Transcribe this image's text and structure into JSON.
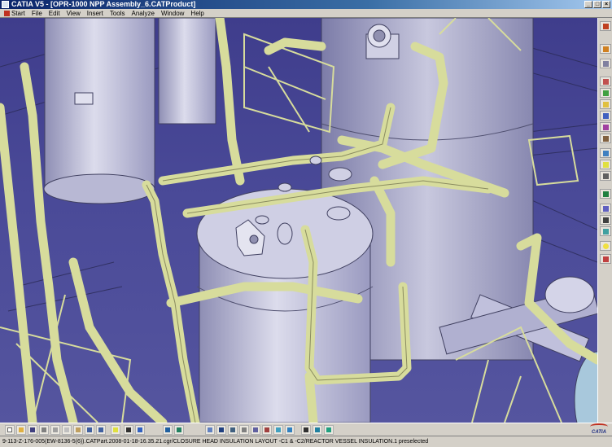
{
  "window": {
    "title": "CATIA V5 - [OPR-1000 NPP Assembly_6.CATProduct]",
    "buttons": [
      "_",
      "□",
      "×"
    ]
  },
  "menubar": {
    "items": [
      "Start",
      "File",
      "Edit",
      "View",
      "Insert",
      "Tools",
      "Analyze",
      "Window",
      "Help"
    ]
  },
  "statusbar": {
    "text": "9-113-Z-176-005(EW-8136-5(6)).CATPart.2008-01-18-16.35.21.cgr/CLOSURE HEAD INSULATION LAYOUT -C1 & -C2/REACTOR VESSEL INSULATION.1 preselected"
  },
  "logo": {
    "text": "CATIA"
  },
  "colors": {
    "pipe": "#d7dc9c",
    "vessel": "#c6c6dc",
    "background": "#4a4a98",
    "chrome": "#d4d0c8"
  },
  "right_toolbar_icons": [
    "select-icon",
    "sketch-icon",
    "fly-icon",
    "section-icon",
    "measure-icon",
    "clash-icon",
    "render-icon",
    "color-icon",
    "material-icon",
    "view-icon",
    "light-icon",
    "camera-icon",
    "annotation-icon",
    "shading-icon",
    "hide-icon",
    "show-icon",
    "bulb-icon",
    "swap-icon"
  ],
  "bottom_toolbar_icons": [
    "new-icon",
    "open-icon",
    "save-icon",
    "print-icon",
    "cut-icon",
    "copy-icon",
    "paste-icon",
    "undo-icon",
    "redo-icon",
    "help-icon",
    "fit-icon",
    "pan-icon",
    "rotate-icon",
    "zoom-in-icon",
    "zoom-out-icon",
    "normal-view-icon",
    "iso-view-icon",
    "shading-icon",
    "hide-show-icon",
    "swap-space-icon"
  ]
}
